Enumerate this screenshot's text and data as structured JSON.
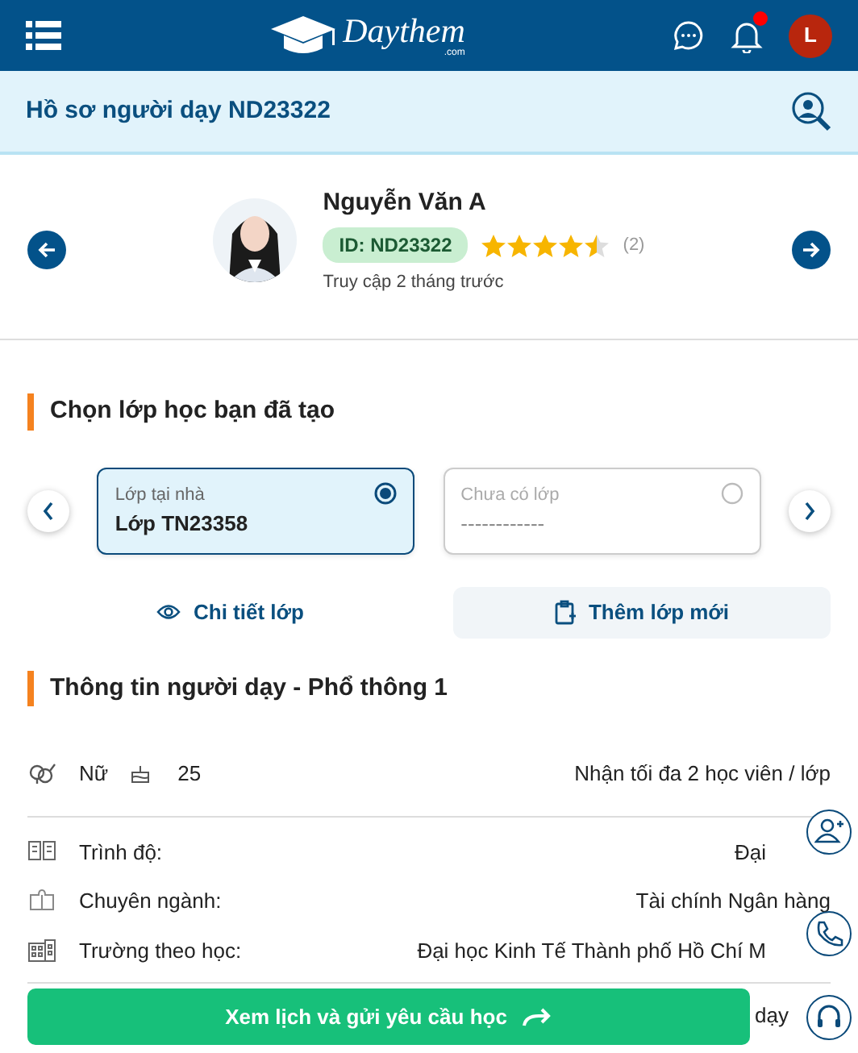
{
  "header": {
    "logo_text": "Daythem",
    "logo_sub": ".com",
    "notification_dot": true,
    "avatar_letter": "L"
  },
  "page_title": "Hồ sơ người dạy ND23322",
  "profile": {
    "name": "Nguyễn Văn A",
    "id_badge": "ID: ND23322",
    "stars": 4.5,
    "review_count": "(2)",
    "last_access": "Truy cập 2 tháng trước"
  },
  "class_section": {
    "title": "Chọn lớp học bạn đã tạo",
    "classes": [
      {
        "label": "Lớp tại nhà",
        "value": "Lớp TN23358",
        "selected": true
      },
      {
        "label": "Chưa có lớp",
        "value": "------------",
        "selected": false
      }
    ],
    "detail_link": "Chi tiết lớp",
    "add_button": "Thêm lớp mới"
  },
  "info_section": {
    "title": "Thông tin người dạy - Phổ thông 1",
    "gender": "Nữ",
    "age": "25",
    "capacity": "Nhận tối đa 2 học viên / lớp",
    "rows": [
      {
        "kind": "level",
        "label": "Trình độ:",
        "value": "Đại"
      },
      {
        "kind": "major",
        "label": "Chuyên ngành:",
        "value": "Tài chính Ngân hàng"
      },
      {
        "kind": "school",
        "label": "Trường theo học:",
        "value": "Đại học Kinh Tế Thành phố Hồ Chí M"
      }
    ],
    "partial_text": "dạy"
  },
  "cta_button": "Xem lịch và gửi yêu cầu học"
}
